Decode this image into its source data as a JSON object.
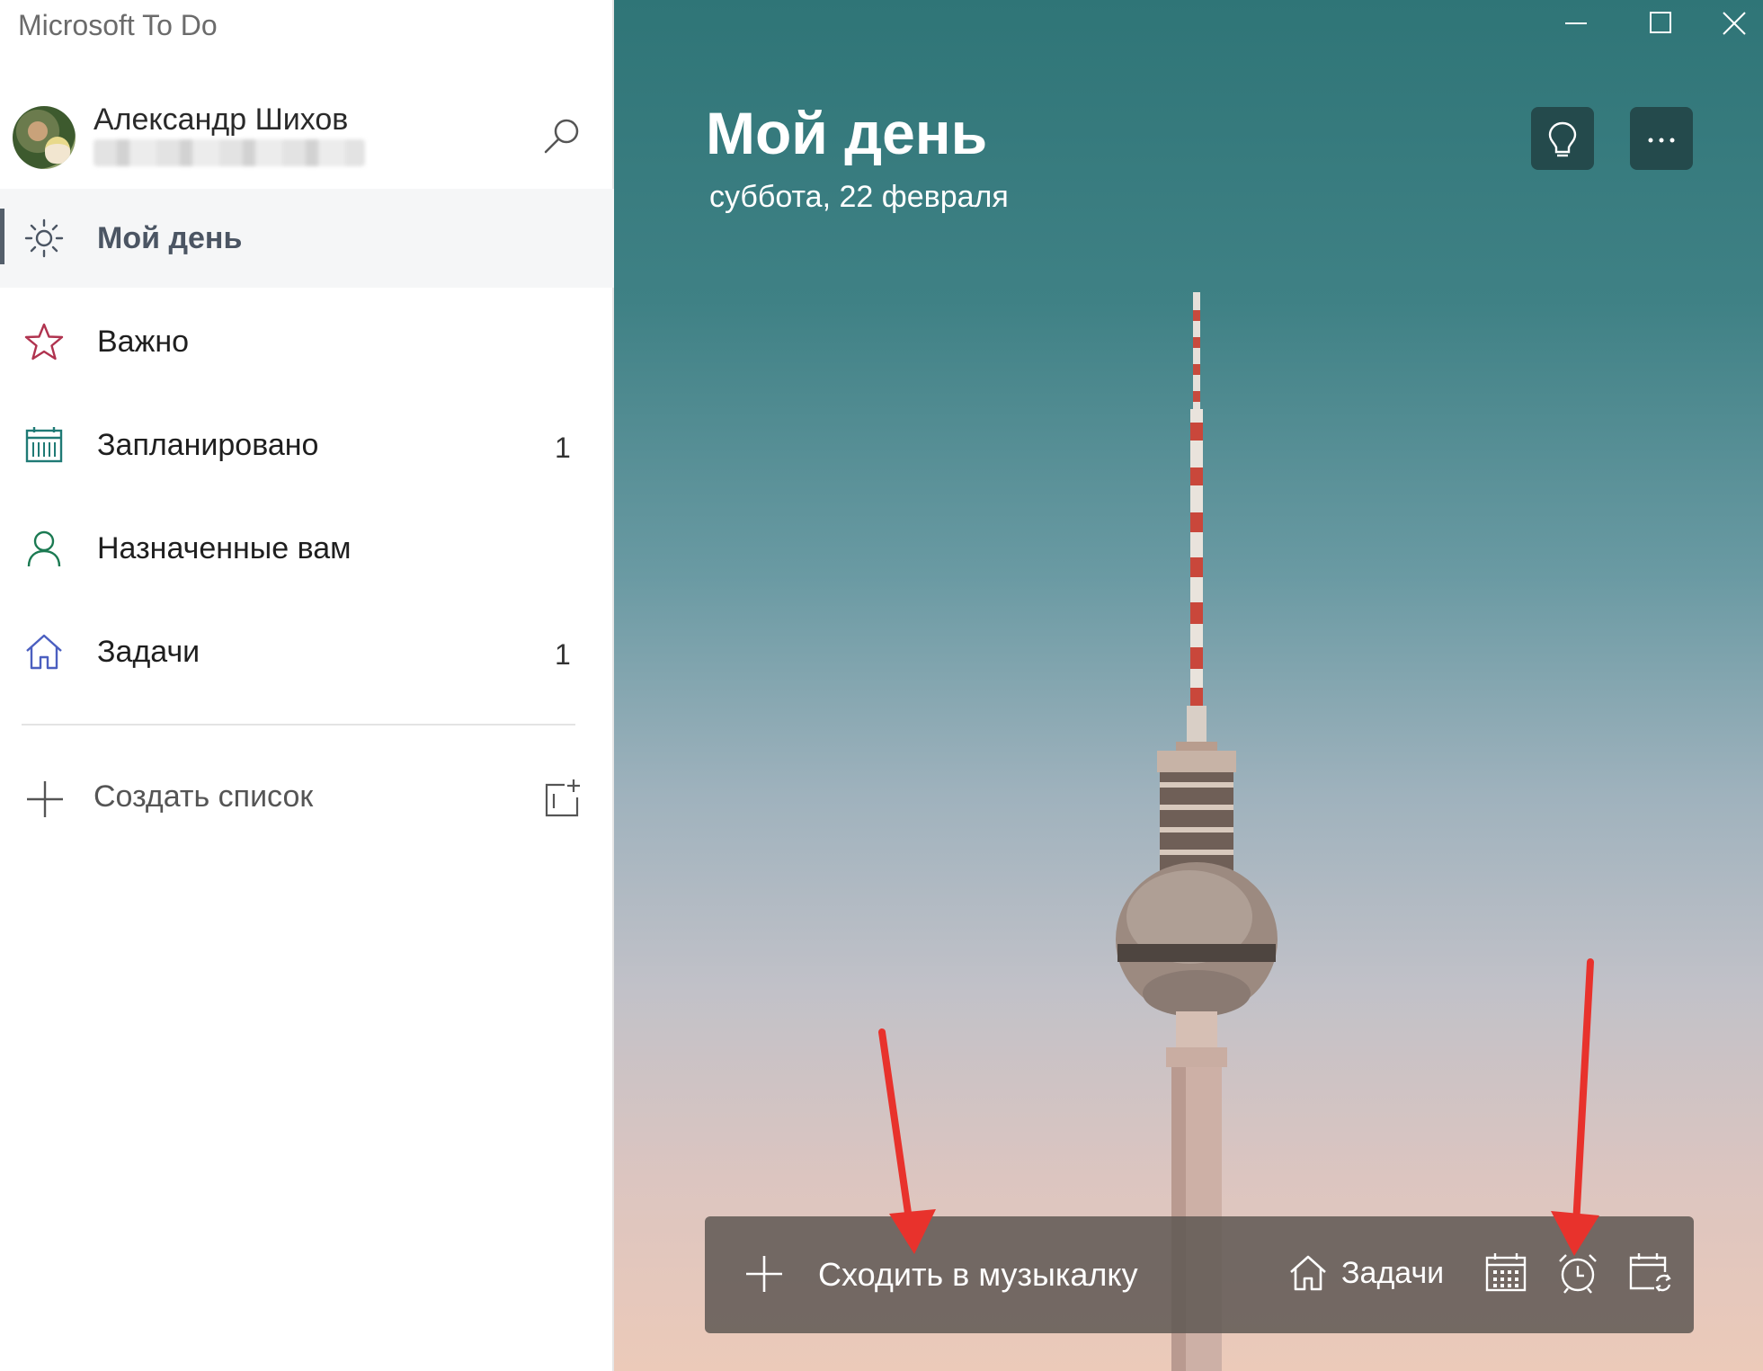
{
  "app": {
    "title": "Microsoft To Do"
  },
  "profile": {
    "name": "Александр Шихов",
    "email_redacted": true,
    "search_icon": "search-icon"
  },
  "nav": {
    "items": [
      {
        "label": "Мой день",
        "icon": "sun-icon",
        "count": "",
        "active": true
      },
      {
        "label": "Важно",
        "icon": "star-icon",
        "count": ""
      },
      {
        "label": "Запланировано",
        "icon": "calendar-icon",
        "count": "1"
      },
      {
        "label": "Назначенные вам",
        "icon": "person-icon",
        "count": ""
      },
      {
        "label": "Задачи",
        "icon": "home-icon",
        "count": "1"
      }
    ],
    "create_list_label": "Создать список"
  },
  "main": {
    "title": "Мой день",
    "date": "суббота, 22 февраля",
    "add_task": {
      "value": "Сходить в музыкалку",
      "list_name": "Задачи"
    }
  },
  "colors": {
    "star": "#b0334f",
    "calendar": "#1f7a75",
    "person": "#1b7a52",
    "home": "#4b5fc0",
    "arrow": "#e8322c"
  }
}
